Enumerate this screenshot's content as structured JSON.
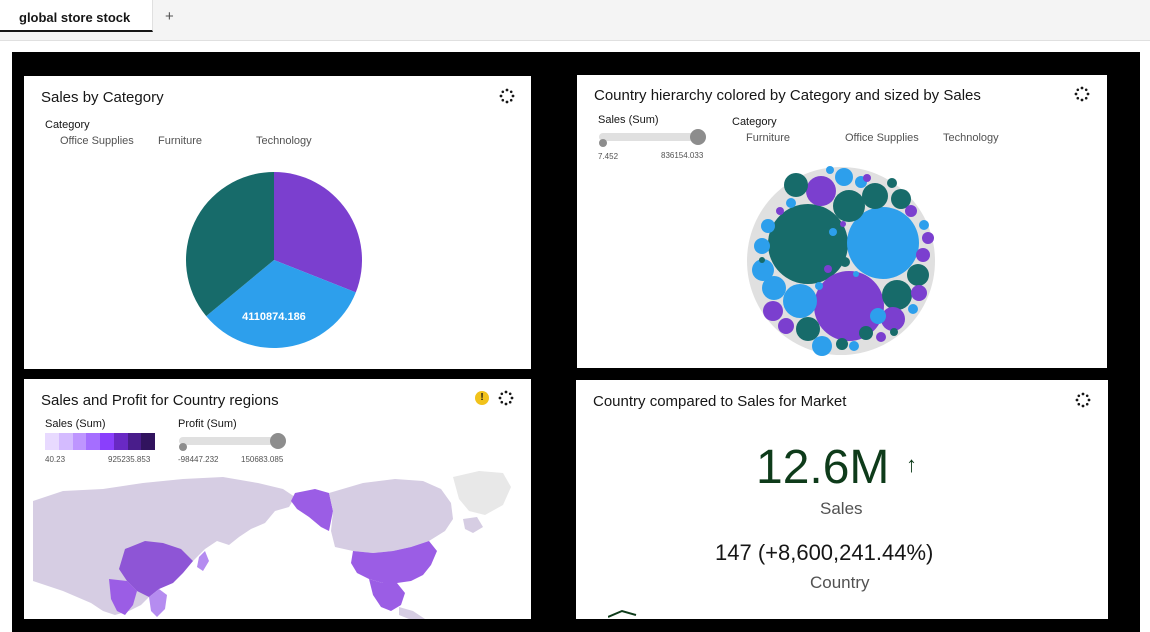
{
  "tabs": {
    "active_label": "global store stock",
    "add_label": "+"
  },
  "widgets": {
    "sales_by_category": {
      "title": "Sales by Category",
      "legend_title": "Category",
      "legend_items": [
        "Office Supplies",
        "Furniture",
        "Technology"
      ],
      "center_label": "4110874.186"
    },
    "country_hierarchy": {
      "title": "Country hierarchy colored by Category and sized by Sales",
      "size_legend_title": "Sales (Sum)",
      "size_min": "7.452",
      "size_max": "836154.033",
      "legend_title": "Category",
      "legend_items": [
        "Furniture",
        "Office Supplies",
        "Technology"
      ]
    },
    "sales_profit_map": {
      "title": "Sales and Profit for Country regions",
      "warning_icon": "!",
      "color_legend_title": "Sales (Sum)",
      "color_min": "40.23",
      "color_max": "925235.853",
      "color_ramp": [
        "#e8daff",
        "#d4bbff",
        "#be95ff",
        "#a56eff",
        "#8a3ffc",
        "#6929c4",
        "#491d8b",
        "#31135e"
      ],
      "size_legend_title": "Profit (Sum)",
      "size_min": "-98447.232",
      "size_max": "150683.085"
    },
    "kpi": {
      "title": "Country compared to Sales for Market",
      "value": "12.6M",
      "arrow": "↑",
      "value_label": "Sales",
      "compare": "147 (+8,600,241.44%)",
      "compare_label": "Country"
    }
  },
  "chart_data": {
    "type": "pie",
    "categories": [
      "Technology",
      "Office Supplies",
      "Furniture"
    ],
    "values": [
      31,
      33,
      36
    ],
    "colors": [
      "#7b3fcf",
      "#2d9fec",
      "#176b6a"
    ],
    "labels": [
      "",
      "4110874.186",
      ""
    ]
  },
  "colors": {
    "purple": "#7b3fcf",
    "blue": "#2d9fec",
    "teal": "#176b6a",
    "kpi_green": "#0e3b1a",
    "map_land": "#d6cde3",
    "map_highlight": "#9b5de5"
  }
}
